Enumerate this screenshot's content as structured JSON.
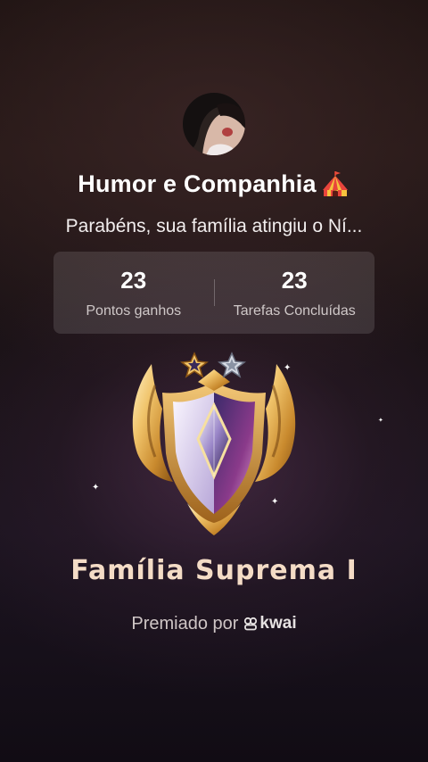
{
  "family": {
    "name": "Humor e Companhia",
    "name_icon": "circus-tent-icon",
    "message": "Parabéns, sua família atingiu o Ní..."
  },
  "stats": [
    {
      "value": "23",
      "label": "Pontos ganhos"
    },
    {
      "value": "23",
      "label": "Tarefas Concluídas"
    }
  ],
  "badge": {
    "icon": "family-rank-shield-icon",
    "stars": [
      "gold-star-icon",
      "silver-star-icon"
    ],
    "rank_title": "Família Suprema I"
  },
  "award": {
    "prefix": "Premiado por",
    "brand": "kwai"
  },
  "colors": {
    "rank_text": "#f4dcc6",
    "badge_gold": "#e8b45a",
    "stats_bg": "rgba(255,255,255,0.12)"
  }
}
